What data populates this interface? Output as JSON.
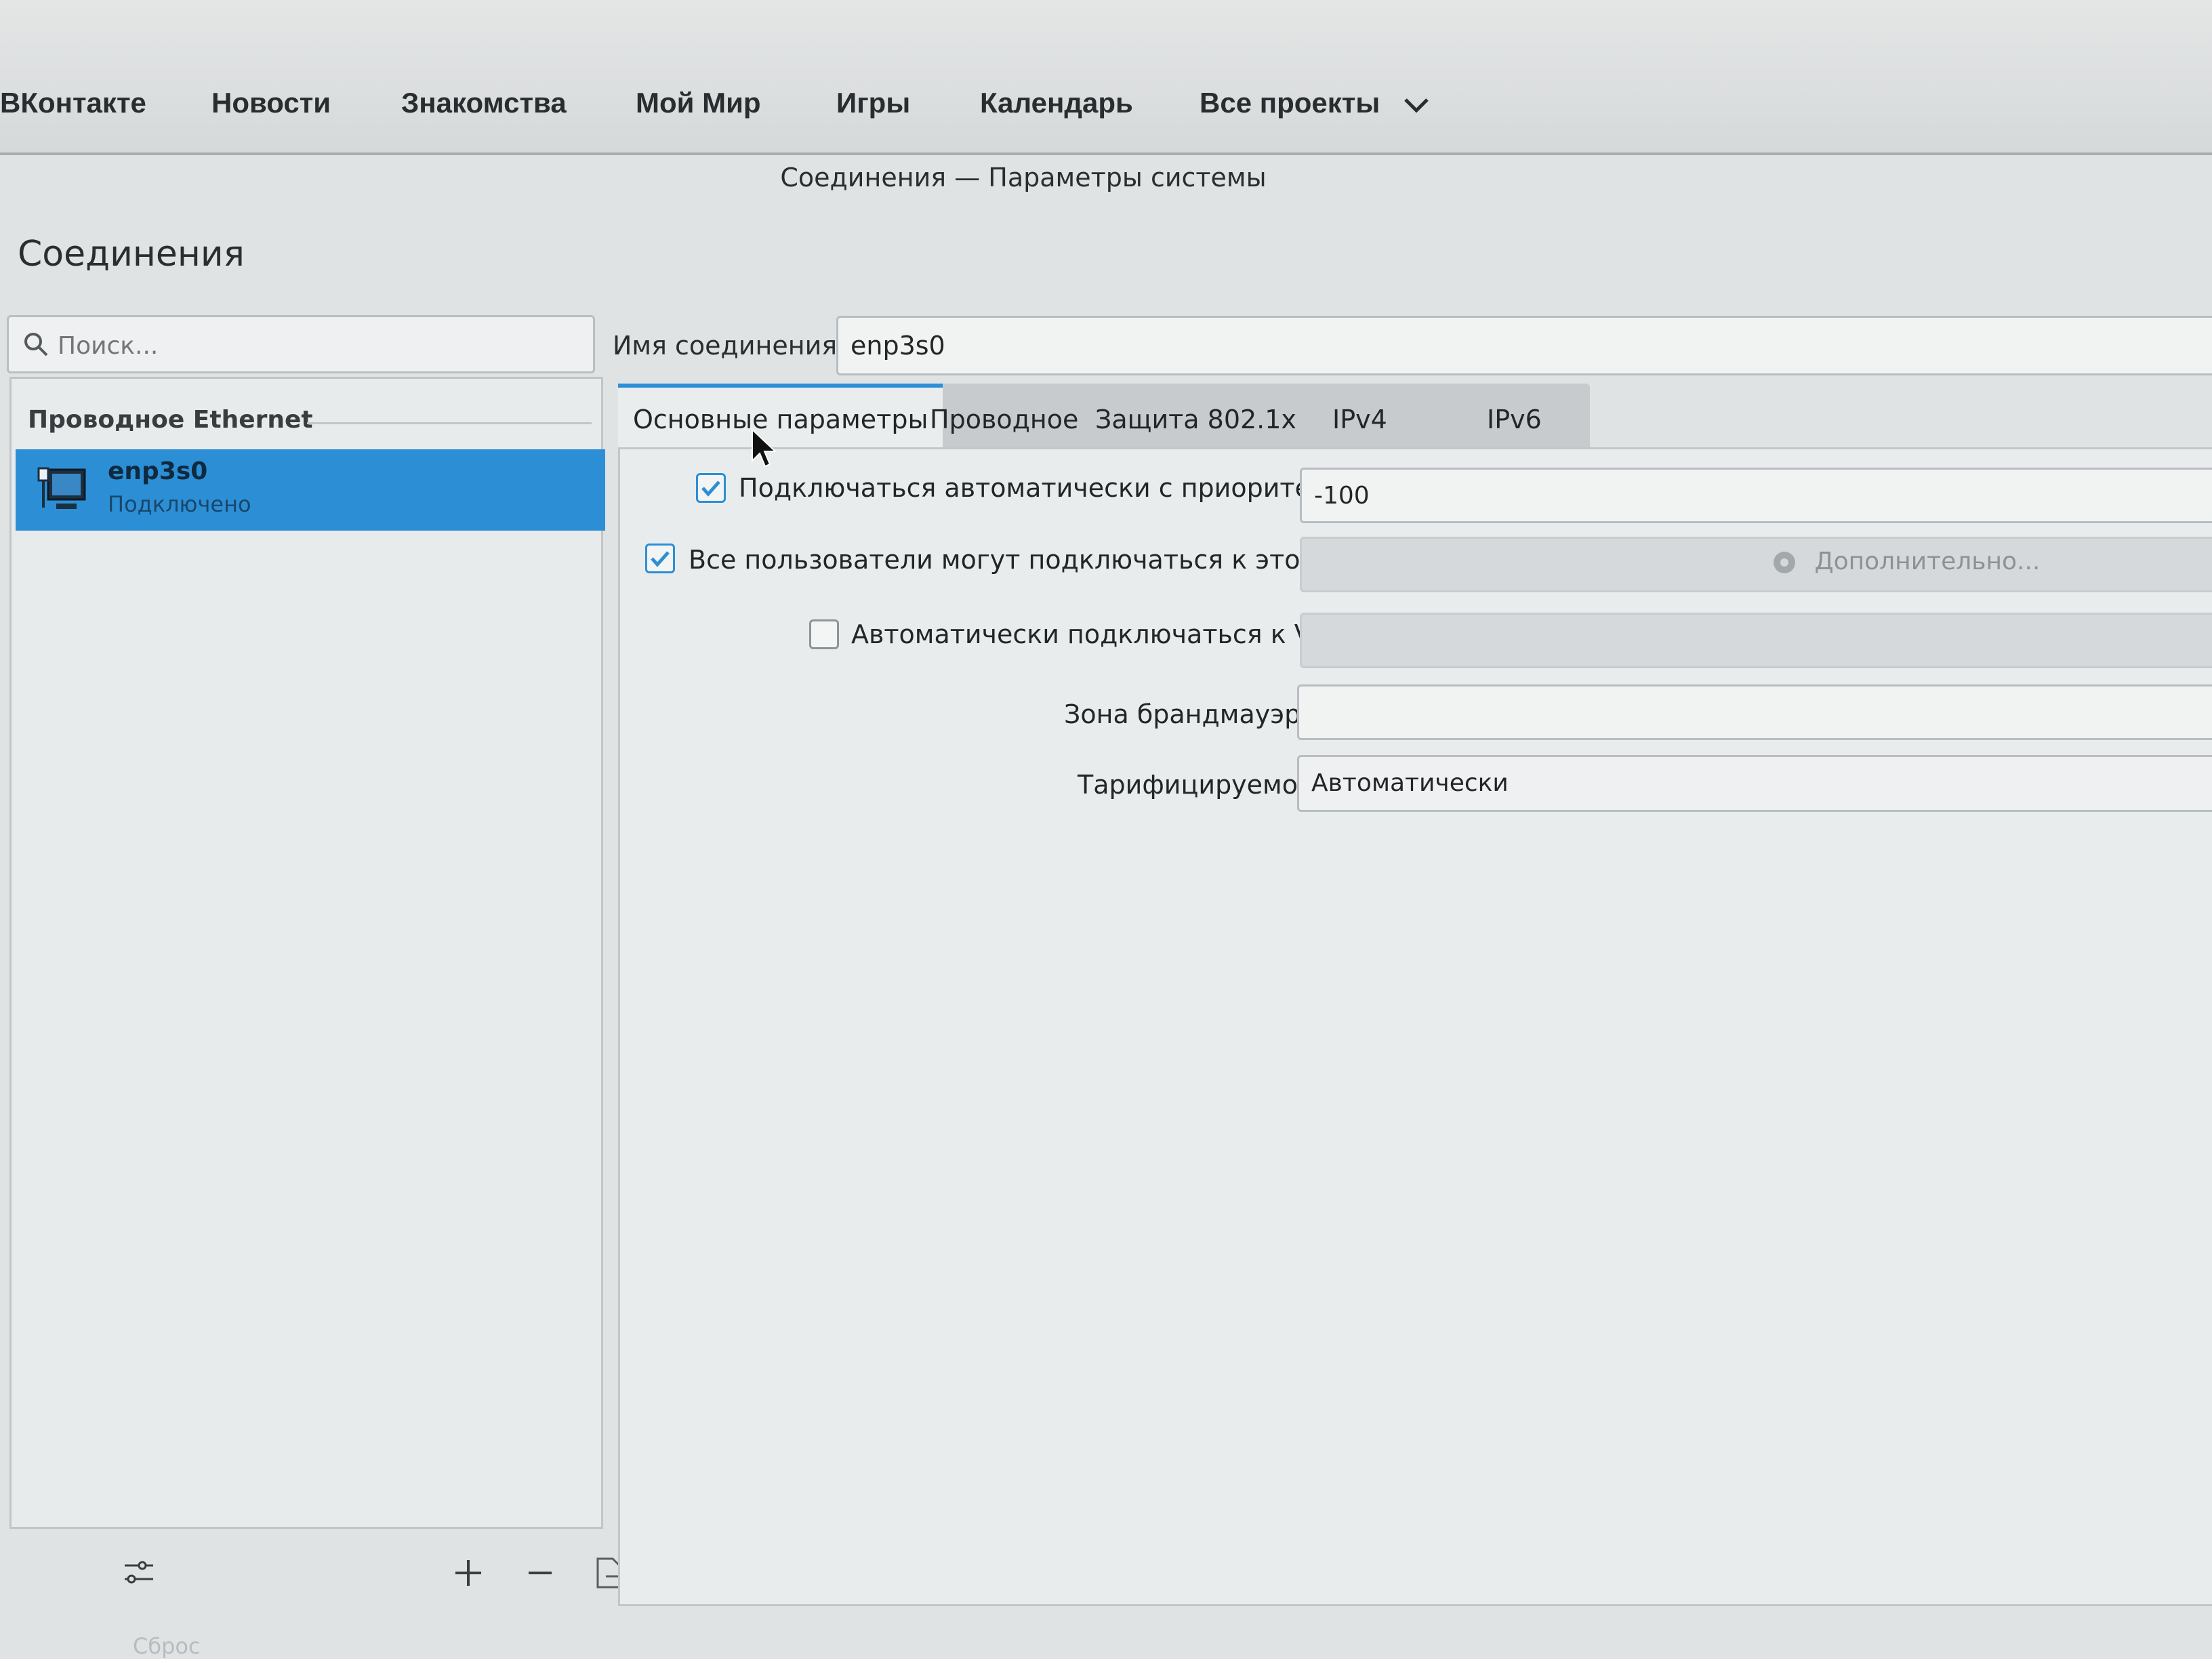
{
  "topnav": {
    "items": [
      "ВКонтакте",
      "Новости",
      "Знакомства",
      "Мой Мир",
      "Игры",
      "Календарь",
      "Все проекты"
    ]
  },
  "window": {
    "title": "Соединения — Параметры системы",
    "page_title": "Соединения"
  },
  "sidebar": {
    "search_placeholder": "Поиск...",
    "group_header": "Проводное Ethernet",
    "connection": {
      "name": "enp3s0",
      "status": "Подключено"
    },
    "reset_label": "Сброс"
  },
  "editor": {
    "name_label": "Имя соединения:",
    "name_value": "enp3s0",
    "tabs": [
      "Основные параметры",
      "Проводное",
      "Защита 802.1x",
      "IPv4",
      "IPv6"
    ],
    "auto_connect_label": "Подключаться автоматически с приоритетом:",
    "auto_connect_checked": true,
    "priority_value": "-100",
    "all_users_label": "Все пользователи могут подключаться к этой сети",
    "all_users_checked": true,
    "advanced_label": "Дополнительно...",
    "vpn_label": "Автоматически подключаться к VPN:",
    "vpn_checked": false,
    "firewall_label": "Зона брандмауэра:",
    "metered_label": "Тарифицируемое:",
    "metered_value": "Автоматически"
  },
  "colors": {
    "accent": "#2c8fd6",
    "background": "#dfe3e4"
  }
}
